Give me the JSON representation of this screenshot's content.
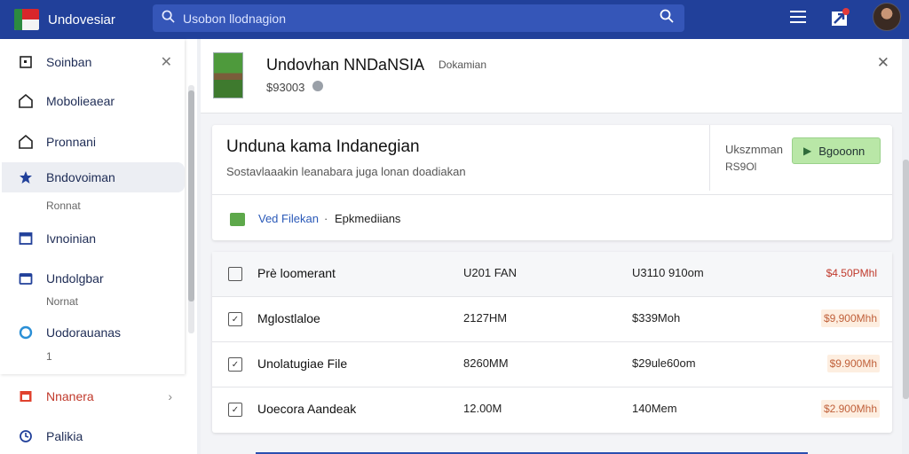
{
  "app": {
    "name": "Undovesiar",
    "search_placeholder": "Usobon llodnagion"
  },
  "sidebar": {
    "items": [
      {
        "label": "Soinban",
        "icon": "square-icon",
        "sub": ""
      },
      {
        "label": "Mobolieaear",
        "icon": "home-icon",
        "sub": ""
      },
      {
        "label": "Pronnani",
        "icon": "home-icon",
        "sub": ""
      },
      {
        "label": "Bndovoiman",
        "icon": "star-icon",
        "sub": "Ronnat"
      },
      {
        "label": "Ivnoinian",
        "icon": "window-icon",
        "sub": ""
      },
      {
        "label": "Undolgbar",
        "icon": "folder-icon",
        "sub": "Nornat"
      },
      {
        "label": "Uodorauanas",
        "icon": "circle-icon",
        "sub": "1"
      },
      {
        "label": "Nnanera",
        "icon": "calendar-icon",
        "sub": ""
      },
      {
        "label": "Palikia",
        "icon": "clock-icon",
        "sub": ""
      }
    ]
  },
  "header": {
    "title": "Undovhan NNDaNSIA",
    "badge": "Dokamian",
    "subtitle": "$93003"
  },
  "info": {
    "title": "Unduna kama Indanegian",
    "description": "Sostavlaaakin leanabara juga lonan doadiakan",
    "side_line1": "Ukszmman",
    "side_line2": "RS9Ol",
    "button_label": "Bgooonn",
    "link_label": "Ved Filekan",
    "link_sep": "·",
    "link_rest": "Epkmediians"
  },
  "table": {
    "rows": [
      {
        "name": "Prè loomerant",
        "col2": "U201 FAN",
        "col3": "U3110 910om",
        "price": "$4.50PMhl",
        "header": true
      },
      {
        "name": "Mglostlaloe",
        "col2": "2127HM",
        "col3": "$339Moh",
        "price": "$9,900Mhh",
        "header": false
      },
      {
        "name": "Unolatugiae File",
        "col2": "8260MM",
        "col3": "$29ule60om",
        "price": "$9.900Mh",
        "header": false
      },
      {
        "name": "Uoecora Aandeak",
        "col2": "12.00M",
        "col3": "140Mem",
        "price": "$2.900Mhh",
        "header": false
      }
    ]
  }
}
